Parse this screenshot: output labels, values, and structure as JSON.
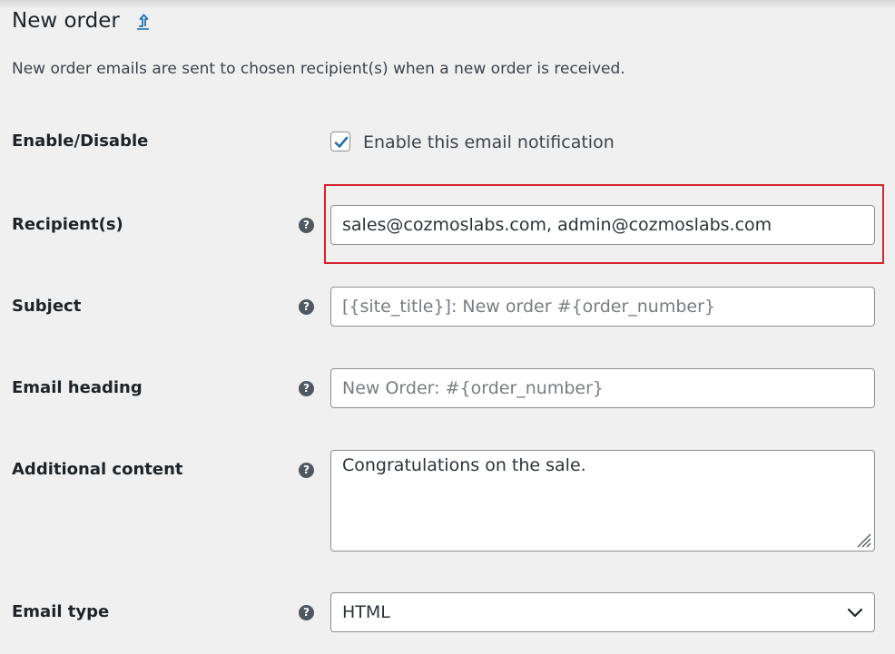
{
  "header": {
    "title": "New order",
    "back_icon": "upload-arrow-icon"
  },
  "intro": "New order emails are sent to chosen recipient(s) when a new order is received.",
  "fields": {
    "enable": {
      "label": "Enable/Disable",
      "checkbox_label": "Enable this email notification",
      "checked": true
    },
    "recipients": {
      "label": "Recipient(s)",
      "value": "sales@cozmoslabs.com, admin@cozmoslabs.com"
    },
    "subject": {
      "label": "Subject",
      "placeholder": "[{site_title}]: New order #{order_number}"
    },
    "heading": {
      "label": "Email heading",
      "placeholder": "New Order: #{order_number}"
    },
    "additional": {
      "label": "Additional content",
      "value": "Congratulations on the sale."
    },
    "email_type": {
      "label": "Email type",
      "value": "HTML"
    }
  },
  "help_glyph": "?",
  "colors": {
    "background": "#f0f0f1",
    "accent": "#2271b1",
    "highlight": "#d9232d"
  }
}
